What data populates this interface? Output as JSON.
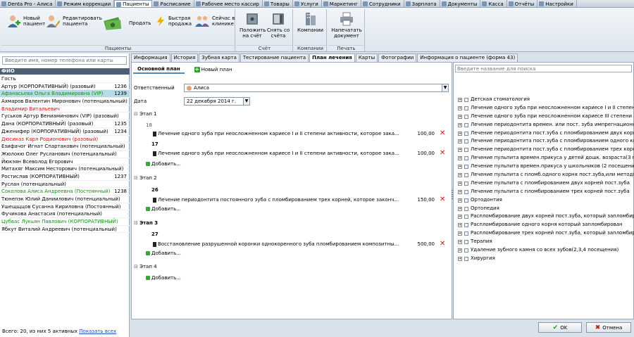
{
  "tabs": [
    {
      "label": "Denta Pro - Алиса"
    },
    {
      "label": "Режим коррекции"
    },
    {
      "label": "Пациенты",
      "active": true
    },
    {
      "label": "Расписание"
    },
    {
      "label": "Рабочее место кассир"
    },
    {
      "label": "Товары"
    },
    {
      "label": "Услуги"
    },
    {
      "label": "Маркетинг"
    },
    {
      "label": "Сотрудники"
    },
    {
      "label": "Зарплата"
    },
    {
      "label": "Документы"
    },
    {
      "label": "Касса"
    },
    {
      "label": "Отчёты"
    },
    {
      "label": "Настройки"
    }
  ],
  "ribbon": {
    "patients_group": "Пациенты",
    "account_group": "Счёт",
    "companies_group": "Компании",
    "print_group": "Печать",
    "new_patient": "Новый пациент",
    "edit_patient": "Редактировать пациента",
    "sell": "Продать",
    "quick_sale": "Быстрая продажа",
    "in_clinic": "Сейчас в клинике",
    "put_on_account": "Положить на счёт",
    "withdraw": "Снять со счёта",
    "companies": "Компании",
    "print_doc": "Напечатать документ"
  },
  "left": {
    "search_placeholder": "Введите имя, номер телефона или карты",
    "list_header": "ФИО",
    "patients": [
      {
        "name": "Гость",
        "num": "",
        "color": "#000000"
      },
      {
        "name": "Артур (КОРПОРАТИВНЫЙ) (разовый)",
        "num": "1236",
        "color": "#000000"
      },
      {
        "name": "Афанасьева Ольга Владимировна (VIP)",
        "num": "1239",
        "color": "#1a8a1a",
        "selected": true
      },
      {
        "name": "Ахмаров Валентин Миронович (потенциальный)",
        "num": "",
        "color": "#000000"
      },
      {
        "name": "Владимир Витальевич",
        "num": "",
        "color": "#d01010"
      },
      {
        "name": "Гуськов Артур Вениаминович (VIP) (разовый)",
        "num": "",
        "color": "#000000"
      },
      {
        "name": "Дана (КОРПОРАТИВНЫЙ) (разовый)",
        "num": "1235",
        "color": "#000000"
      },
      {
        "name": "Дженифер (КОРПОРАТИВНЫЙ) (разовый)",
        "num": "1234",
        "color": "#000000"
      },
      {
        "name": "Дюсиказ Карл Родионович (разовый)",
        "num": "",
        "color": "#d01010"
      },
      {
        "name": "Езифачог Игнат Спартакович (потенциальный)",
        "num": "",
        "color": "#000000"
      },
      {
        "name": "Жюлокю Олег Русланович (потенциальный)",
        "num": "",
        "color": "#000000"
      },
      {
        "name": "Йюкэян Всеволод Егорович",
        "num": "",
        "color": "#000000"
      },
      {
        "name": "Митахяг Максим Несторович (потенциальный)",
        "num": "",
        "color": "#000000"
      },
      {
        "name": "Ростислав (КОРПОРАТИВНЫЙ)",
        "num": "1237",
        "color": "#000000"
      },
      {
        "name": "Руслан (потенциальный)",
        "num": "",
        "color": "#000000"
      },
      {
        "name": "Соколова Алиса Андреевна (Постоянный)",
        "num": "1238",
        "color": "#1a8a1a"
      },
      {
        "name": "Тюнепэк Юлий Даниилович (потенциальный)",
        "num": "",
        "color": "#000000"
      },
      {
        "name": "Ушещщцов Сусанна Кириловна (Постоянный)",
        "num": "",
        "color": "#000000"
      },
      {
        "name": "Фучикова Анастасия (потенциальный)",
        "num": "",
        "color": "#000000"
      },
      {
        "name": "Цубвас Лукьян Павлович (КОРПОРАТИВНЫЙ)",
        "num": "",
        "color": "#1a8a1a"
      },
      {
        "name": "Ябкут Виталий Андреевич (потенциальный)",
        "num": "",
        "color": "#000000"
      }
    ],
    "footer_text": "Всего: 20, из них 5 активных",
    "footer_link": "Показать всех"
  },
  "center_tabs": [
    {
      "label": "Информация"
    },
    {
      "label": "История"
    },
    {
      "label": "Зубная карта"
    },
    {
      "label": "Тестирование пациента"
    },
    {
      "label": "План лечения",
      "active": true
    },
    {
      "label": "Карты"
    },
    {
      "label": "Фотографии"
    },
    {
      "label": "Информация о пациенте (форма 43)"
    }
  ],
  "plan": {
    "subtab_main": "Основной план",
    "subtab_new": "Новый план",
    "responsible_label": "Ответственный",
    "responsible_value": "Алиса",
    "date_label": "Дата",
    "date_value": "22 декабря  2014 г.",
    "add_label": "Добавить...",
    "stage1": "Этап 1",
    "stage2": "Этап 2",
    "stage3": "Этап 3",
    "stage4": "Этап 4",
    "s1_t1": "18",
    "s1_t1_proc": "Лечение одного зуба при неосложненном кариесе I и II степени активности, которое зака...",
    "s1_t1_price": "100,00",
    "s1_t2": "17",
    "s1_t2_proc": "Лечение одного зуба при неосложненном кариесе I и II степени активности, которое зака...",
    "s1_t2_price": "100,00",
    "s2_t1": "26",
    "s2_t1_proc": "Лечение периодонтита постоянного зуба с пломбированием трех корней, которое законч...",
    "s2_t1_price": "150,00",
    "s3_t1": "27",
    "s3_t1_proc": "Восстановление разрушенной коронки однокоренного зуба пломбированием композитны...",
    "s3_t1_price": "500,00"
  },
  "right": {
    "search_placeholder": "Введите название для поиска",
    "tree": [
      "Детская стоматология",
      "Лечение одного зуба при неосложненном кариесе I и II степени акт",
      "Лечение одного зуба при неосложненном кариесе III степени акт. и",
      "Лечение периодонтита времен. или пост. зуба импрегнационным ме",
      "Лечение периодонтита пост.зуба с пломбированием двух корней",
      "Лечение периодонтита пост.зуба с пломбированием одного корня",
      "Лечение периодонтита пост.зуба с пломбированием трех корней",
      "Лечение пульпита времен.прикуса у детей дошк. возраста(3 посе",
      "Лечение пульпита времен.прикуса у школьников (2 посещения)",
      "Лечение пульпита с пломб.одного корня пост.зуба,или методом п",
      "Лечение пульпита с пломбированием двух корней пост.зуба",
      "Лечение пульпита с пломбированием трех корней пост.зуба",
      "Ортодонтия",
      "Ортопедия",
      "Распломбирование двух корней пост.зуба, который запломбирован",
      "Распломбирование одного корня который запломбирован",
      "Распломбирование трех корней пост.зуба, который запломбирован",
      "Терапия",
      "Удаление зубного камня со всех зубов(2,3,4 посещения)",
      "Хирургия"
    ]
  },
  "buttons": {
    "ok": "OK",
    "cancel": "Отмена"
  }
}
